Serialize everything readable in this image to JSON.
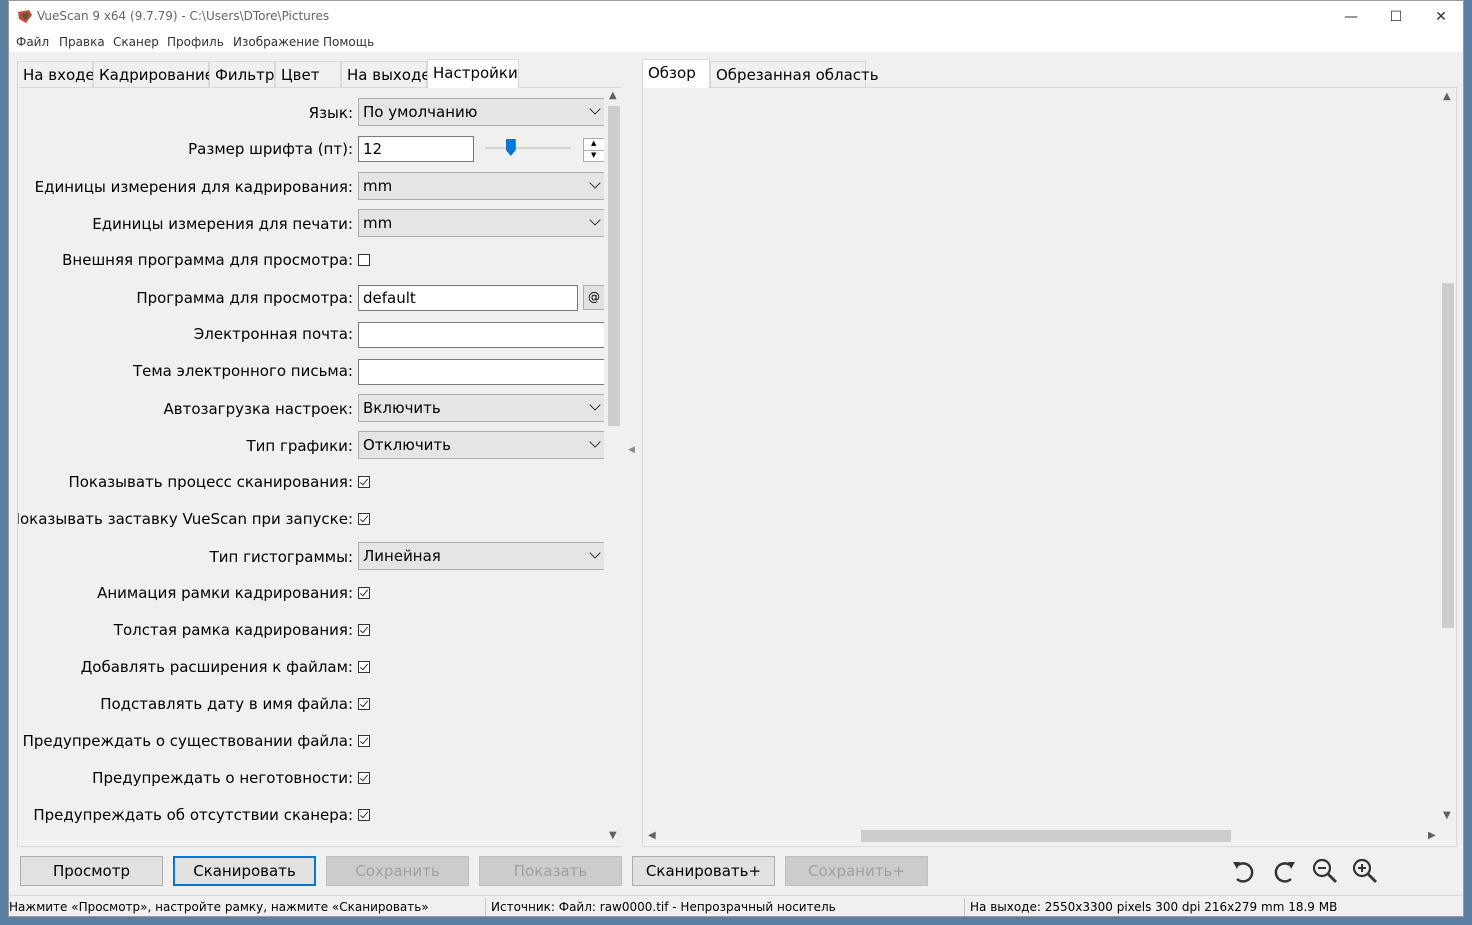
{
  "window": {
    "title": "VueScan 9 x64 (9.7.79) - C:\\Users\\DTore\\Pictures",
    "controls": {
      "minimize": "—",
      "maximize": "☐",
      "close": "✕"
    }
  },
  "menu": [
    "Файл",
    "Правка",
    "Сканер",
    "Профиль",
    "Изображение",
    "Помощь"
  ],
  "left_tabs": [
    "На входе",
    "Кадрирование",
    "Фильтр",
    "Цвет",
    "На выходе",
    "Настройки"
  ],
  "active_left_tab": "Настройки",
  "right_tabs": [
    "Обзор",
    "Обрезанная область"
  ],
  "active_right_tab": "Обзор",
  "settings": {
    "language": {
      "label": "Язык:",
      "value": "По умолчанию"
    },
    "font_size": {
      "label": "Размер шрифта (пт):",
      "value": "12"
    },
    "crop_units": {
      "label": "Единицы измерения для кадрирования:",
      "value": "mm"
    },
    "print_units": {
      "label": "Единицы измерения для печати:",
      "value": "mm"
    },
    "external_viewer": {
      "label": "Внешняя программа для просмотра:",
      "checked": false
    },
    "viewer_program": {
      "label": "Программа для просмотра:",
      "value": "default",
      "button": "@"
    },
    "email": {
      "label": "Электронная почта:",
      "value": ""
    },
    "email_subject": {
      "label": "Тема электронного письма:",
      "value": ""
    },
    "autoload": {
      "label": "Автозагрузка настроек:",
      "value": "Включить"
    },
    "graphics_type": {
      "label": "Тип графики:",
      "value": "Отключить"
    },
    "show_progress": {
      "label": "Показывать процесс сканирования:",
      "checked": true
    },
    "show_splash": {
      "label": "Показывать заставку VueScan при запуске:",
      "checked": true
    },
    "histogram_type": {
      "label": "Тип гистограммы:",
      "value": "Линейная"
    },
    "animate_crop": {
      "label": "Анимация рамки кадрирования:",
      "checked": true
    },
    "thick_crop": {
      "label": "Толстая рамка кадрирования:",
      "checked": true
    },
    "add_extensions": {
      "label": "Добавлять расширения к файлам:",
      "checked": true
    },
    "date_filename": {
      "label": "Подставлять дату в имя файла:",
      "checked": true
    },
    "warn_exists": {
      "label": "Предупреждать о существовании файла:",
      "checked": true
    },
    "warn_not_ready": {
      "label": "Предупреждать о неготовности:",
      "checked": true
    },
    "warn_no_scanner": {
      "label": "Предупреждать об отсутствии сканера:",
      "checked": true
    }
  },
  "font_slider_level": 0.3,
  "buttons": {
    "preview": "Просмотр",
    "scan": "Сканировать",
    "save": "Сохранить",
    "show": "Показать",
    "scan_plus": "Сканировать+",
    "save_plus": "Сохранить+"
  },
  "toolbar_icons": [
    "rotate-left-icon",
    "rotate-right-icon",
    "zoom-out-icon",
    "zoom-in-icon"
  ],
  "status": {
    "hint": "Нажмите «Просмотр», настройте рамку, нажмите «Сканировать»",
    "source": "Источник: Файл: raw0000.tif - Непрозрачный носитель",
    "output": "На выходе: 2550x3300 pixels 300 dpi 216x279 mm 18.9 MB"
  },
  "colors": {
    "accent": "#0078d7",
    "window_bg": "#f0f0f0",
    "panel_bg": "#ffffff"
  }
}
